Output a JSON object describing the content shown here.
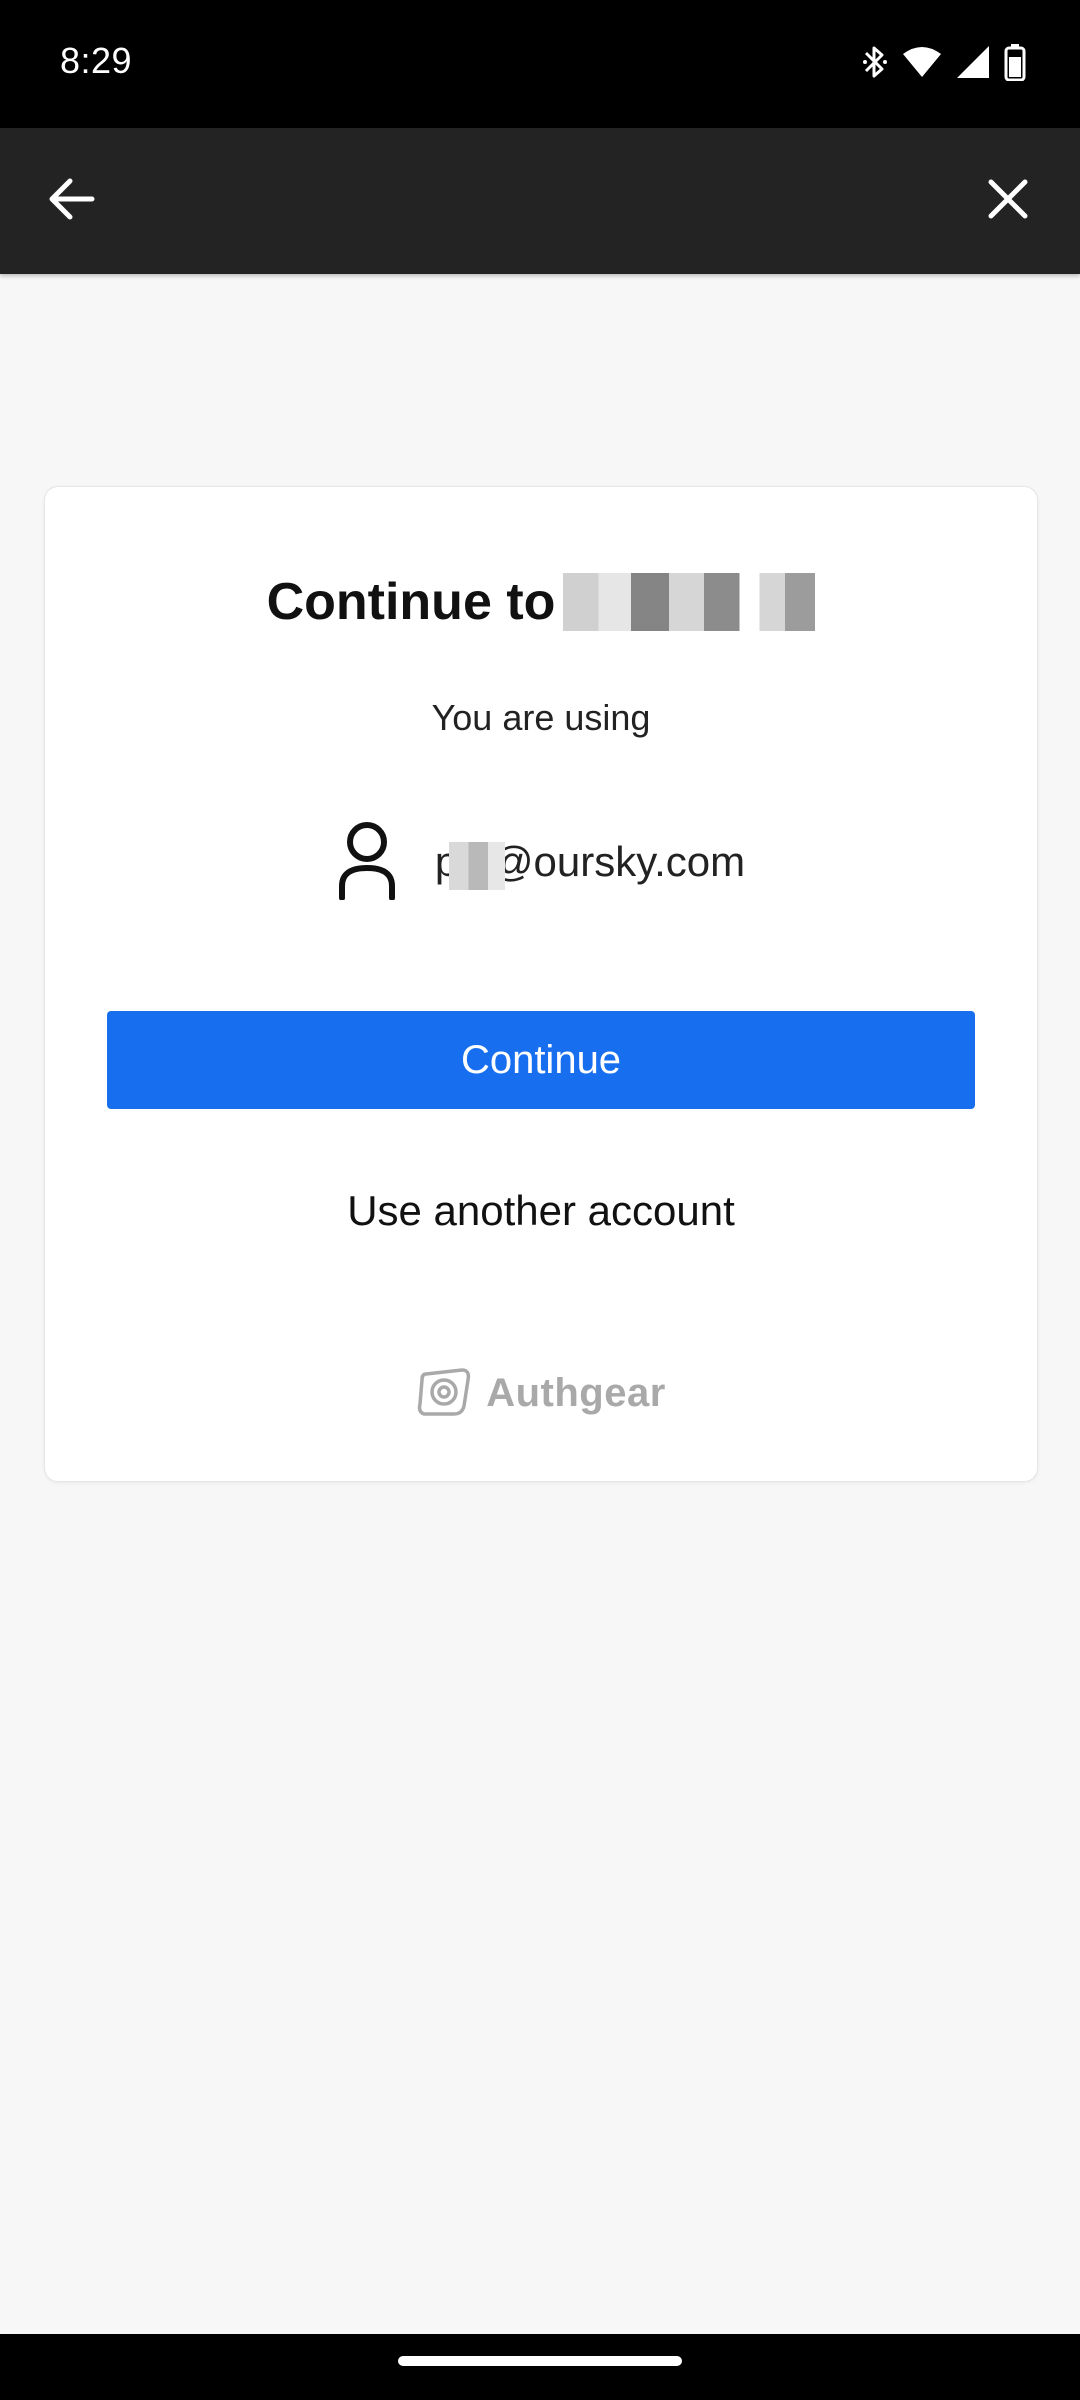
{
  "status_bar": {
    "time": "8:29",
    "icons": [
      "bluetooth-icon",
      "wifi-icon",
      "cellular-signal-icon",
      "battery-icon"
    ]
  },
  "toolbar": {
    "back_icon": "arrow-left-icon",
    "close_icon": "close-icon"
  },
  "card": {
    "title_prefix": "Continue to",
    "subtitle": "You are using",
    "account_icon": "user-icon",
    "email": "p  s@oursky.com",
    "continue_label": "Continue",
    "another_account_label": "Use another account",
    "brand_name": "Authgear"
  },
  "colors": {
    "primary": "#176ff0",
    "toolbar": "#232323",
    "background": "#f7f7f7",
    "brand_gray": "#a9a9a9"
  }
}
